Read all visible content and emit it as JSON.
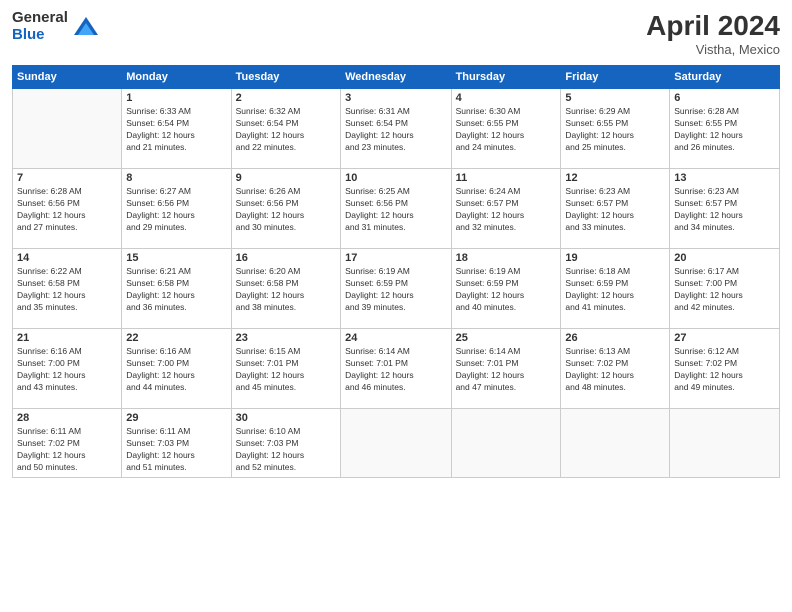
{
  "header": {
    "logo_general": "General",
    "logo_blue": "Blue",
    "month_year": "April 2024",
    "location": "Vistha, Mexico"
  },
  "days_of_week": [
    "Sunday",
    "Monday",
    "Tuesday",
    "Wednesday",
    "Thursday",
    "Friday",
    "Saturday"
  ],
  "weeks": [
    [
      {
        "day": "",
        "info": ""
      },
      {
        "day": "1",
        "info": "Sunrise: 6:33 AM\nSunset: 6:54 PM\nDaylight: 12 hours\nand 21 minutes."
      },
      {
        "day": "2",
        "info": "Sunrise: 6:32 AM\nSunset: 6:54 PM\nDaylight: 12 hours\nand 22 minutes."
      },
      {
        "day": "3",
        "info": "Sunrise: 6:31 AM\nSunset: 6:54 PM\nDaylight: 12 hours\nand 23 minutes."
      },
      {
        "day": "4",
        "info": "Sunrise: 6:30 AM\nSunset: 6:55 PM\nDaylight: 12 hours\nand 24 minutes."
      },
      {
        "day": "5",
        "info": "Sunrise: 6:29 AM\nSunset: 6:55 PM\nDaylight: 12 hours\nand 25 minutes."
      },
      {
        "day": "6",
        "info": "Sunrise: 6:28 AM\nSunset: 6:55 PM\nDaylight: 12 hours\nand 26 minutes."
      }
    ],
    [
      {
        "day": "7",
        "info": "Sunrise: 6:28 AM\nSunset: 6:56 PM\nDaylight: 12 hours\nand 27 minutes."
      },
      {
        "day": "8",
        "info": "Sunrise: 6:27 AM\nSunset: 6:56 PM\nDaylight: 12 hours\nand 29 minutes."
      },
      {
        "day": "9",
        "info": "Sunrise: 6:26 AM\nSunset: 6:56 PM\nDaylight: 12 hours\nand 30 minutes."
      },
      {
        "day": "10",
        "info": "Sunrise: 6:25 AM\nSunset: 6:56 PM\nDaylight: 12 hours\nand 31 minutes."
      },
      {
        "day": "11",
        "info": "Sunrise: 6:24 AM\nSunset: 6:57 PM\nDaylight: 12 hours\nand 32 minutes."
      },
      {
        "day": "12",
        "info": "Sunrise: 6:23 AM\nSunset: 6:57 PM\nDaylight: 12 hours\nand 33 minutes."
      },
      {
        "day": "13",
        "info": "Sunrise: 6:23 AM\nSunset: 6:57 PM\nDaylight: 12 hours\nand 34 minutes."
      }
    ],
    [
      {
        "day": "14",
        "info": "Sunrise: 6:22 AM\nSunset: 6:58 PM\nDaylight: 12 hours\nand 35 minutes."
      },
      {
        "day": "15",
        "info": "Sunrise: 6:21 AM\nSunset: 6:58 PM\nDaylight: 12 hours\nand 36 minutes."
      },
      {
        "day": "16",
        "info": "Sunrise: 6:20 AM\nSunset: 6:58 PM\nDaylight: 12 hours\nand 38 minutes."
      },
      {
        "day": "17",
        "info": "Sunrise: 6:19 AM\nSunset: 6:59 PM\nDaylight: 12 hours\nand 39 minutes."
      },
      {
        "day": "18",
        "info": "Sunrise: 6:19 AM\nSunset: 6:59 PM\nDaylight: 12 hours\nand 40 minutes."
      },
      {
        "day": "19",
        "info": "Sunrise: 6:18 AM\nSunset: 6:59 PM\nDaylight: 12 hours\nand 41 minutes."
      },
      {
        "day": "20",
        "info": "Sunrise: 6:17 AM\nSunset: 7:00 PM\nDaylight: 12 hours\nand 42 minutes."
      }
    ],
    [
      {
        "day": "21",
        "info": "Sunrise: 6:16 AM\nSunset: 7:00 PM\nDaylight: 12 hours\nand 43 minutes."
      },
      {
        "day": "22",
        "info": "Sunrise: 6:16 AM\nSunset: 7:00 PM\nDaylight: 12 hours\nand 44 minutes."
      },
      {
        "day": "23",
        "info": "Sunrise: 6:15 AM\nSunset: 7:01 PM\nDaylight: 12 hours\nand 45 minutes."
      },
      {
        "day": "24",
        "info": "Sunrise: 6:14 AM\nSunset: 7:01 PM\nDaylight: 12 hours\nand 46 minutes."
      },
      {
        "day": "25",
        "info": "Sunrise: 6:14 AM\nSunset: 7:01 PM\nDaylight: 12 hours\nand 47 minutes."
      },
      {
        "day": "26",
        "info": "Sunrise: 6:13 AM\nSunset: 7:02 PM\nDaylight: 12 hours\nand 48 minutes."
      },
      {
        "day": "27",
        "info": "Sunrise: 6:12 AM\nSunset: 7:02 PM\nDaylight: 12 hours\nand 49 minutes."
      }
    ],
    [
      {
        "day": "28",
        "info": "Sunrise: 6:11 AM\nSunset: 7:02 PM\nDaylight: 12 hours\nand 50 minutes."
      },
      {
        "day": "29",
        "info": "Sunrise: 6:11 AM\nSunset: 7:03 PM\nDaylight: 12 hours\nand 51 minutes."
      },
      {
        "day": "30",
        "info": "Sunrise: 6:10 AM\nSunset: 7:03 PM\nDaylight: 12 hours\nand 52 minutes."
      },
      {
        "day": "",
        "info": ""
      },
      {
        "day": "",
        "info": ""
      },
      {
        "day": "",
        "info": ""
      },
      {
        "day": "",
        "info": ""
      }
    ]
  ]
}
